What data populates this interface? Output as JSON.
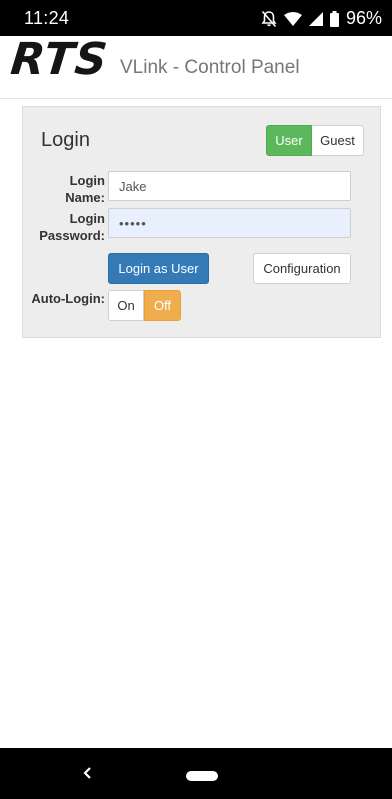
{
  "status_bar": {
    "time": "11:24",
    "battery": "96%",
    "icons": [
      "notifications-off-icon",
      "wifi-icon",
      "signal-icon",
      "battery-icon"
    ]
  },
  "header": {
    "logo": "RTS",
    "title": "VLink - Control Panel"
  },
  "login_panel": {
    "title": "Login",
    "mode_toggle": {
      "options": [
        "User",
        "Guest"
      ],
      "selected": "User"
    },
    "login_name": {
      "label": "Login Name:",
      "value": "Jake"
    },
    "login_password": {
      "label_line1": "Login",
      "label_line2": "Password:",
      "value": "•••••"
    },
    "login_button": "Login as User",
    "configuration_button": "Configuration",
    "auto_login": {
      "label": "Auto-Login:",
      "options": [
        "On",
        "Off"
      ],
      "selected": "Off"
    }
  },
  "nav_bar": {
    "icons": [
      "back-icon",
      "home-icon"
    ]
  },
  "colors": {
    "success": "#5cb85c",
    "primary": "#337ab7",
    "warning": "#f0ad4e",
    "panel_bg": "#ededed"
  }
}
